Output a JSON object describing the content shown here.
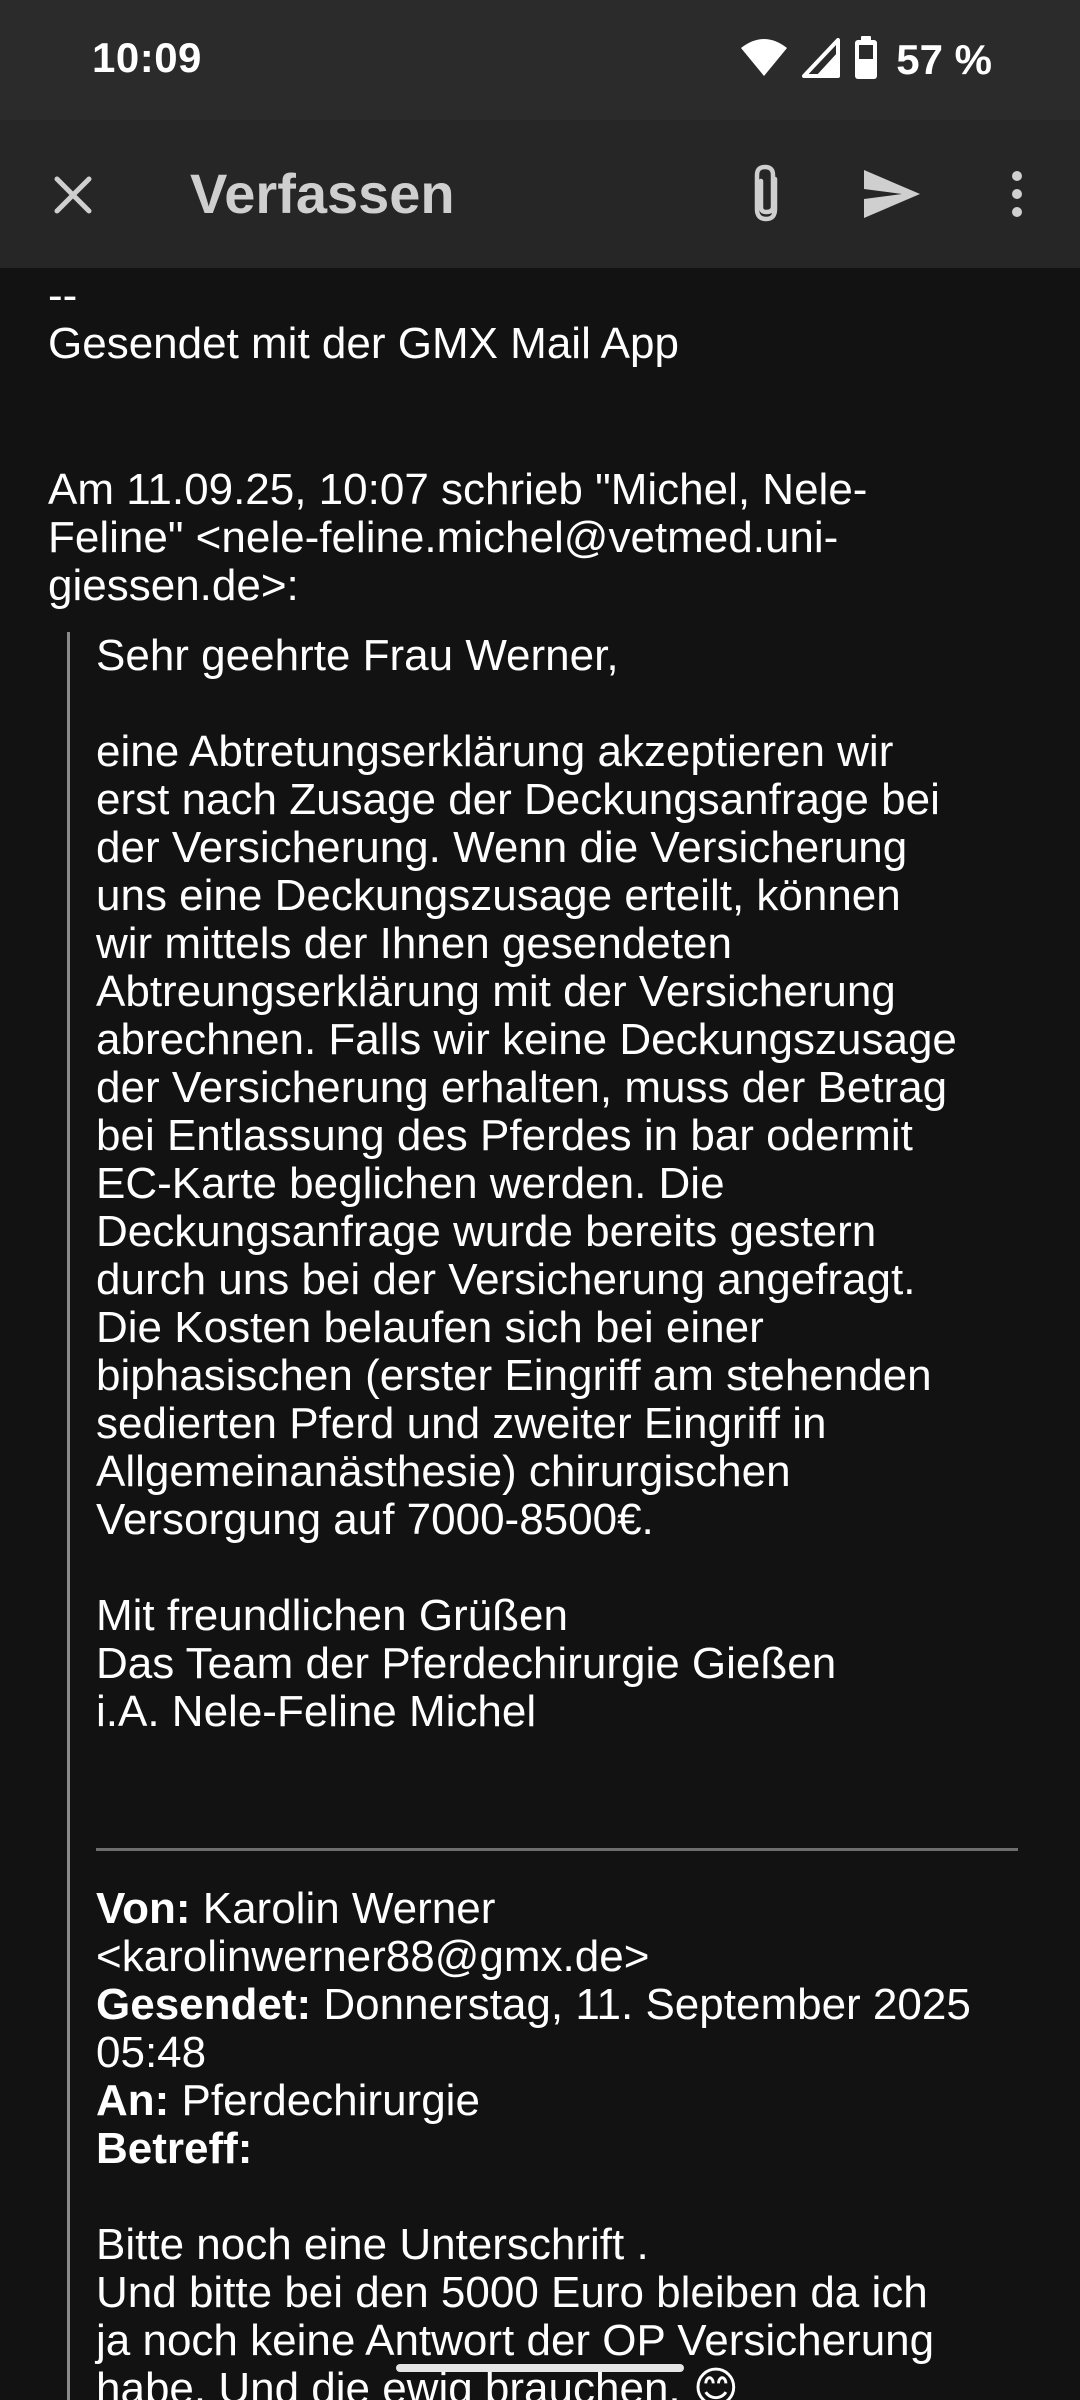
{
  "status_bar": {
    "time": "10:09",
    "battery_percent": "57 %",
    "icons": [
      "wifi-icon",
      "cell-signal-icon",
      "battery-icon"
    ]
  },
  "app_bar": {
    "title": "Verfassen",
    "icons": [
      "close-icon",
      "attachment-icon",
      "send-icon",
      "more-vert-icon"
    ]
  },
  "signature": {
    "dash": "--",
    "text": "Gesendet mit der GMX Mail App"
  },
  "quote_header": {
    "lines": [
      "Am 11.09.25, 10:07 schrieb \"Michel, Nele-",
      "Feline\" <nele-feline.michel@vetmed.uni-",
      "giessen.de>:"
    ]
  },
  "quoted_message": {
    "greeting": "Sehr geehrte Frau Werner,",
    "body_lines": [
      "eine Abtretungserklärung akzeptieren wir",
      "erst nach Zusage der Deckungsanfrage bei",
      "der Versicherung. Wenn die Versicherung",
      "uns eine Deckungszusage erteilt, können",
      "wir mittels der Ihnen gesendeten",
      "Abtreungserklärung mit der Versicherung",
      "abrechnen. Falls wir keine Deckungszusage",
      "der Versicherung erhalten, muss der Betrag",
      "bei Entlassung des Pferdes in bar odermit",
      "EC-Karte beglichen werden. Die",
      "Deckungsanfrage wurde bereits gestern",
      "durch uns bei der Versicherung angefragt.",
      "Die Kosten belaufen sich bei einer",
      "biphasischen (erster Eingriff am stehenden",
      "sedierten Pferd und zweiter Eingriff in",
      "Allgemeinanästhesie) chirurgischen",
      "Versorgung auf 7000-8500€."
    ],
    "closing_lines": [
      "Mit freundlichen Grüßen",
      "Das Team der Pferdechirurgie Gießen",
      "i.A. Nele-Feline Michel"
    ]
  },
  "original_meta": {
    "from_label": "Von:",
    "from_value_line1": "Karolin Werner",
    "from_value_line2": "<karolinwerner88@gmx.de>",
    "sent_label": "Gesendet:",
    "sent_value_line1": "Donnerstag, 11. September 2025",
    "sent_value_line2": "05:48",
    "to_label": "An:",
    "to_value": "Pferdechirurgie",
    "subject_label": "Betreff:",
    "subject_value": ""
  },
  "original_message": {
    "lines": [
      "Bitte noch eine Unterschrift .",
      "Und bitte bei den 5000 Euro bleiben da ich",
      "ja noch keine Antwort der OP Versicherung",
      "habe. Und die ewig brauchen. 😊"
    ]
  }
}
